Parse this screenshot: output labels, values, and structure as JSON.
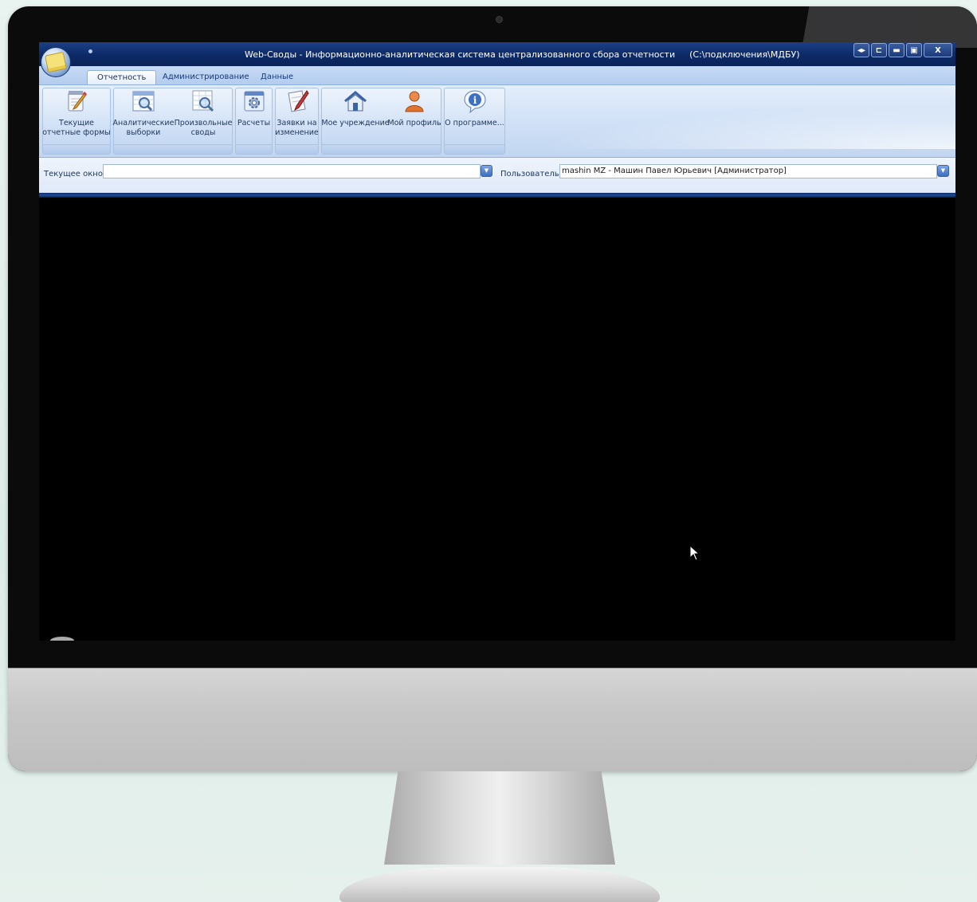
{
  "window": {
    "title": "Web-Своды - Информационно-аналитическая система централизованного сбора отчетности",
    "connection": "(C:\\подключения\\МДБУ)",
    "controls": [
      "◂▸",
      "⊏",
      "▬",
      "▣",
      "X"
    ]
  },
  "tabs": [
    {
      "label": "Отчетность",
      "active": true
    },
    {
      "label": "Администрирование",
      "active": false
    },
    {
      "label": "Данные",
      "active": false
    }
  ],
  "ribbon": {
    "buttons": [
      {
        "line1": "Текущие",
        "line2": "отчетные формы",
        "icon": "notepad-pencil-icon"
      },
      {
        "line1": "Аналитические",
        "line2": "выборки",
        "icon": "magnifier-table-icon"
      },
      {
        "line1": "Произвольные",
        "line2": "своды",
        "icon": "magnifier-grid-icon"
      },
      {
        "line1": "Расчеты",
        "line2": "",
        "icon": "calc-gear-icon"
      },
      {
        "line1": "Заявки на",
        "line2": "изменение",
        "icon": "document-pen-icon"
      },
      {
        "line1": "Мое учреждение",
        "line2": "",
        "icon": "house-icon"
      },
      {
        "line1": "Мой профиль",
        "line2": "",
        "icon": "user-profile-icon"
      },
      {
        "line1": "О программе...",
        "line2": "",
        "icon": "info-bubble-icon"
      }
    ]
  },
  "address_bar": {
    "current_window_label": "Текущее окно:",
    "current_window_value": "",
    "user_label": "Пользователь:",
    "user_value": "mashin MZ - Машин Павел Юрьевич  [Администратор]"
  },
  "colors": {
    "titlebar": "#0d2a66",
    "ribbon": "#d2e2f7",
    "content": "#000000",
    "text": "#1f3558"
  }
}
